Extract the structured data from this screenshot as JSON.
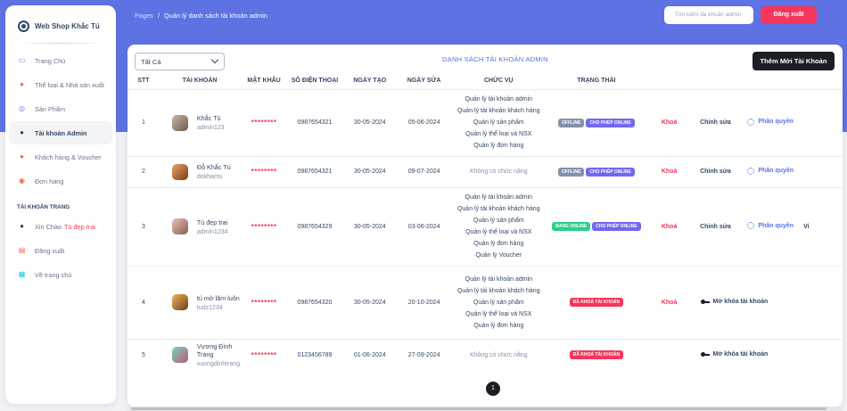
{
  "sidebar": {
    "brand": "Web Shop Khắc Tú",
    "items": [
      {
        "label": "Trang Chủ",
        "icon": "tv-icon"
      },
      {
        "label": "Thể loại & Nhà sản xuất",
        "icon": "category-icon"
      },
      {
        "label": "Sản Phẩm",
        "icon": "globe-icon"
      },
      {
        "label": "Tài khoản Admin",
        "icon": "user-icon",
        "active": true
      },
      {
        "label": "Khách hàng & Voucher",
        "icon": "customer-icon"
      },
      {
        "label": "Đơn hàng",
        "icon": "order-icon"
      }
    ],
    "account_section": "TÀI KHOẢN TRANG",
    "account_items": [
      {
        "label": "Xin Chào",
        "extra": "Tú đẹp trai",
        "icon": "user-icon"
      },
      {
        "label": "Đăng xuất",
        "icon": "logout-icon"
      },
      {
        "label": "Về trang chủ",
        "icon": "home-icon"
      }
    ]
  },
  "header": {
    "breadcrumb_root": "Pages",
    "breadcrumb_sep": "/",
    "breadcrumb_current": "Quản lý danh sách tài khoản admin",
    "search_placeholder": "Tìm kiếm tài khoản admin",
    "logout_label": "Đăng xuất"
  },
  "card": {
    "filter_value": "Tất Cả",
    "title": "DANH SÁCH TÀI KHOẢN ADMIN",
    "add_button": "Thêm Mới Tài Khoản"
  },
  "table": {
    "columns": [
      "STT",
      "TÀI KHOẢN",
      "MẬT KHẨU",
      "SỐ ĐIỆN THOẠI",
      "NGÀY TẠO",
      "NGÀY SỬA",
      "CHỨC VỤ",
      "TRẠNG THÁI"
    ],
    "rows": [
      {
        "stt": "1",
        "name": "Khắc Tú",
        "account": "admin123",
        "password": "********",
        "phone": "0987654321",
        "created": "30-05-2024",
        "updated": "05-06-2024",
        "roles": [
          "Quản lý tài khoản admin",
          "Quản lý tài khoản khách hàng",
          "Quản lý sản phẩm",
          "Quản lý thể loại và NSX",
          "Quản lý đơn hàng"
        ],
        "badges": [
          "OFFLINE",
          "CHO PHÉP ONLINE"
        ],
        "lock": "Khoá",
        "edit": "Chỉnh sửa",
        "role_action": "Phân quyền"
      },
      {
        "stt": "2",
        "name": "Đỗ Khắc Tú",
        "account": "dokhactu",
        "password": "********",
        "phone": "0987654321",
        "created": "30-05-2024",
        "updated": "09-07-2024",
        "no_roles": "Không có chức năng",
        "badges": [
          "OFFLINE",
          "CHO PHÉP ONLINE"
        ],
        "lock": "Khoá",
        "edit": "Chỉnh sửa",
        "role_action": "Phân quyền"
      },
      {
        "stt": "3",
        "name": "Tú đẹp trai",
        "account": "admin1234",
        "password": "********",
        "phone": "0987654329",
        "created": "30-05-2024",
        "updated": "03-06-2024",
        "roles": [
          "Quản lý tài khoản admin",
          "Quản lý tài khoản khách hàng",
          "Quản lý sản phẩm",
          "Quản lý thể loại và NSX",
          "Quản lý đơn hàng",
          "Quản lý Voucher"
        ],
        "badges": [
          "ĐANG ONLINE",
          "CHO PHÉP ONLINE"
        ],
        "lock": "Khoá",
        "edit": "Chỉnh sửa",
        "role_action": "Phân quyền",
        "view": "Vi"
      },
      {
        "stt": "4",
        "name": "tú mờ lâm luôn",
        "account": "tudz1234",
        "password": "********",
        "phone": "0987654320",
        "created": "30-05-2024",
        "updated": "20-10-2024",
        "roles": [
          "Quản lý tài khoản admin",
          "Quản lý tài khoản khách hàng",
          "Quản lý sản phẩm",
          "Quản lý thể loại và NSX",
          "Quản lý đơn hàng"
        ],
        "badges": [
          "ĐÃ KHOÁ TÀI KHOẢN"
        ],
        "lock": "Khoá",
        "unlock": "Mở khóa tài khoản"
      },
      {
        "stt": "5",
        "name": "Vương Đình Trang",
        "account": "vuongdinhtrang",
        "password": "********",
        "phone": "0123456789",
        "created": "01-06-2024",
        "updated": "27-09-2024",
        "no_roles": "Không có chức năng",
        "badges": [
          "ĐÃ KHOÁ TÀI KHOẢN"
        ],
        "unlock": "Mở khóa tài khoản"
      }
    ]
  },
  "pagination": {
    "current": "1"
  },
  "colors": {
    "primary": "#5e72e4",
    "danger": "#f5365c",
    "success": "#2dce89",
    "dark": "#1b1e23"
  }
}
